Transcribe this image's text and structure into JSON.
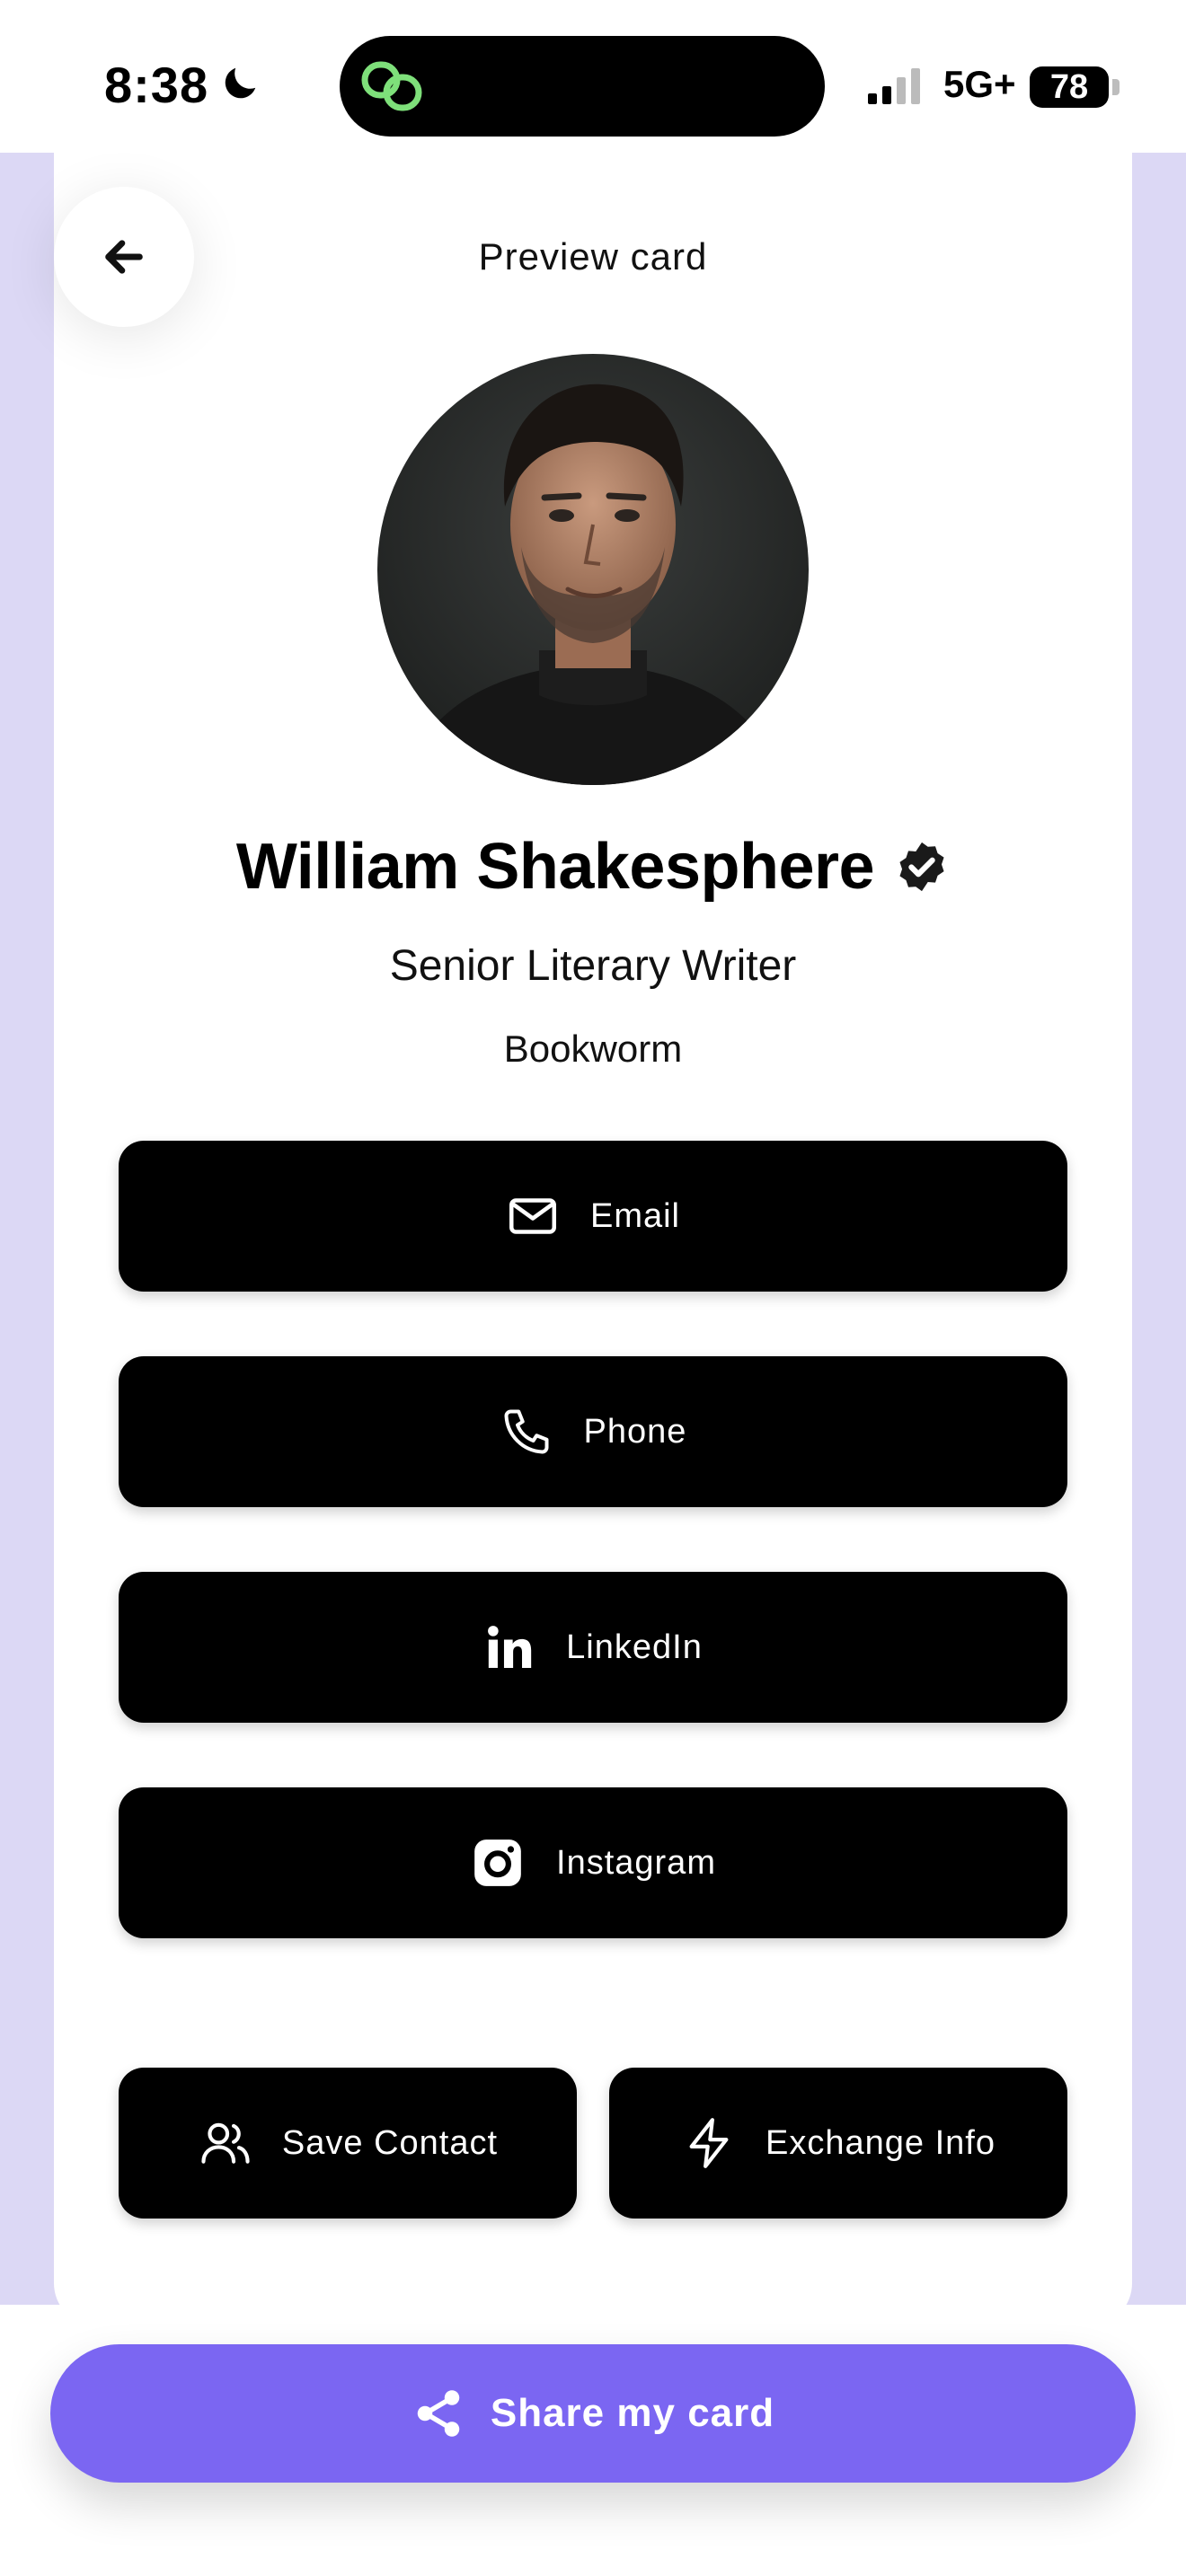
{
  "status_bar": {
    "time": "8:38",
    "network": "5G+",
    "battery": "78"
  },
  "header": {
    "title": "Preview card",
    "back_icon": "arrow-left-icon"
  },
  "profile": {
    "name": "William Shakesphere",
    "job_title": "Senior Literary Writer",
    "tagline": "Bookworm",
    "verified_icon": "verified-badge-icon"
  },
  "links": [
    {
      "label": "Email",
      "icon": "mail-icon"
    },
    {
      "label": "Phone",
      "icon": "phone-icon"
    },
    {
      "label": "LinkedIn",
      "icon": "linkedin-icon"
    },
    {
      "label": "Instagram",
      "icon": "instagram-icon"
    }
  ],
  "actions": {
    "save_contact": "Save Contact",
    "exchange_info": "Exchange Info"
  },
  "share": {
    "label": "Share my card"
  },
  "colors": {
    "accent": "#7b66f2",
    "background_tint": "#dcd8f5",
    "button": "#000000",
    "island_logo": "#7ee07a"
  }
}
